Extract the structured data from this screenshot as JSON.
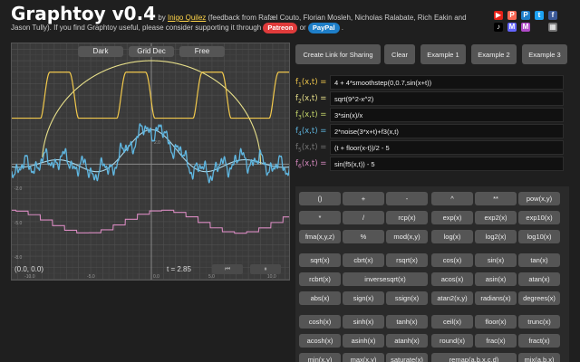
{
  "header": {
    "title": "Graphtoy v0.4",
    "by": "by",
    "author": "Inigo Quilez",
    "credits": "(feedback from Rafæl Couto, Florian Mosleh, Nicholas Ralabate, Rich Eakin and Jason Tully). If you find Graphtoy useful, please consider supporting it through",
    "patreon": "Patreon",
    "or": "or",
    "paypal": "PayPal",
    "end": "."
  },
  "social": [
    {
      "name": "youtube-icon",
      "glyph": "▶",
      "color": "#e62117"
    },
    {
      "name": "patreon-icon",
      "glyph": "P",
      "color": "#f96854"
    },
    {
      "name": "paypal-icon",
      "glyph": "P",
      "color": "#1e7ec8"
    },
    {
      "name": "twitter-icon",
      "glyph": "t",
      "color": "#1da1f2"
    },
    {
      "name": "facebook-icon",
      "glyph": "f",
      "color": "#3b5998"
    },
    {
      "name": "tiktok-icon",
      "glyph": "♪",
      "color": "#000000"
    },
    {
      "name": "mastodon-icon",
      "glyph": "M",
      "color": "#6364ff"
    },
    {
      "name": "medium-icon",
      "glyph": "M",
      "color": "#b04ac8"
    },
    {
      "name": "image-icon",
      "glyph": "▦",
      "color": "#777777"
    }
  ],
  "plot": {
    "buttons": [
      "Dark",
      "Grid Dec",
      "Free"
    ],
    "coords": "(0.0, 0.0)",
    "time": "t = 2.85",
    "rewind_icon": "⏮",
    "pause_icon": "⏸",
    "axis_labels": {
      "y_top": "2.0",
      "y_mid": "-2.0",
      "y_low": "-5.0",
      "y_bottom": "-8.0",
      "x_left": "-10.0",
      "x_left2": "-5.0",
      "x_mid": "0.0",
      "x_right2": "5.0",
      "x_right": "10.0"
    },
    "colors": {
      "bg": "#3a3a3a",
      "grid_major": "#4f4f4f",
      "grid_minor": "#434343",
      "f1": "#f2c94c",
      "f2": "#e8e08a",
      "f3": "#5fb6e0",
      "f4": "#a7d8ec",
      "f6": "#d88ac0"
    }
  },
  "toolbar": {
    "create_link": "Create Link for Sharing",
    "clear": "Clear",
    "example1": "Example 1",
    "example2": "Example 2",
    "example3": "Example 3"
  },
  "formulas": [
    {
      "label": "f",
      "sub": "1",
      "args": "(x,t) =",
      "expr": "4 + 4*smoothstep(0,0.7,sin(x+t))",
      "color": "#f2c94c"
    },
    {
      "label": "f",
      "sub": "2",
      "args": "(x,t) =",
      "expr": "sqrt(9^2-x^2)",
      "color": "#e8e08a"
    },
    {
      "label": "f",
      "sub": "3",
      "args": "(x,t) =",
      "expr": "3*sin(x)/x",
      "color": "#c6d86b"
    },
    {
      "label": "f",
      "sub": "4",
      "args": "(x,t) =",
      "expr": "2*noise(3*x+t)+f3(x,t)",
      "color": "#5fb6e0"
    },
    {
      "label": "f",
      "sub": "5",
      "args": "(x,t) =",
      "expr": "(t + floor(x-t))/2 - 5",
      "color": "#777777"
    },
    {
      "label": "f",
      "sub": "6",
      "args": "(x,t) =",
      "expr": "sin(f5(x,t)) - 5",
      "color": "#d88ac0"
    }
  ],
  "keypad": [
    [
      "()",
      "+",
      "-",
      "^",
      "**",
      "pow(x,y)"
    ],
    [
      "*",
      "/",
      "rcp(x)",
      "exp(x)",
      "exp2(x)",
      "exp10(x)"
    ],
    [
      "fma(x,y,z)",
      "%",
      "mod(x,y)",
      "log(x)",
      "log2(x)",
      "log10(x)"
    ],
    [
      "sqrt(x)",
      "cbrt(x)",
      "rsqrt(x)",
      "cos(x)",
      "sin(x)",
      "tan(x)"
    ],
    [
      "rcbrt(x)",
      "inversesqrt(x)",
      "acos(x)",
      "asin(x)",
      "atan(x)"
    ],
    [
      "abs(x)",
      "sign(x)",
      "ssign(x)",
      "atan2(x,y)",
      "radians(x)",
      "degrees(x)"
    ],
    [
      "cosh(x)",
      "sinh(x)",
      "tanh(x)",
      "ceil(x)",
      "floor(x)",
      "trunc(x)"
    ],
    [
      "acosh(x)",
      "asinh(x)",
      "atanh(x)",
      "round(x)",
      "frac(x)",
      "fract(x)"
    ],
    [
      "min(x,y)",
      "max(x,y)",
      "saturate(x)",
      "remap(a,b,x,c,d)",
      "mix(a,b,x)"
    ]
  ]
}
